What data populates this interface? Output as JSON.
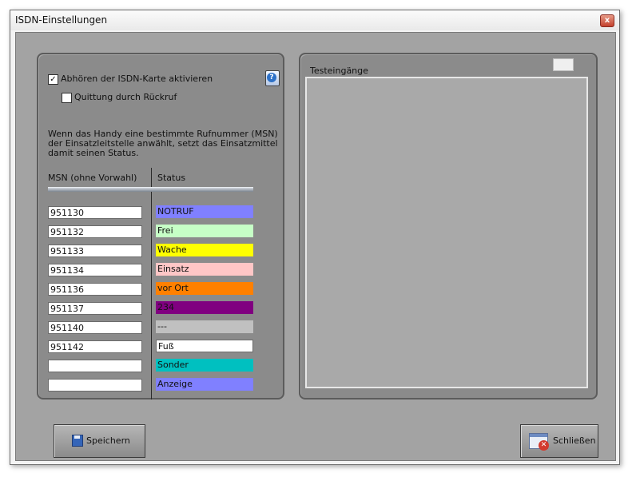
{
  "window": {
    "title": "ISDN-Einstellungen",
    "close_symbol": "x"
  },
  "options": {
    "isdn_listen": {
      "label": "Abhören der ISDN-Karte aktivieren",
      "checked": true
    },
    "callback_ack": {
      "label": "Quittung durch Rückruf",
      "checked": false
    }
  },
  "description": "Wenn das Handy eine bestimmte Rufnummer (MSN)  der Einsatzleitstelle anwählt, setzt das Einsatzmittel damit seinen Status.",
  "table": {
    "col_msn": "MSN (ohne Vorwahl)",
    "col_status": "Status",
    "rows": [
      {
        "msn": "951130",
        "status": "NOTRUF",
        "color": "#8080ff"
      },
      {
        "msn": "951132",
        "status": "Frei",
        "color": "#c6ffc6"
      },
      {
        "msn": "951133",
        "status": "Wache",
        "color": "#ffff00"
      },
      {
        "msn": "951134",
        "status": "Einsatz",
        "color": "#ffc6c6"
      },
      {
        "msn": "951136",
        "status": "vor Ort",
        "color": "#ff8000"
      },
      {
        "msn": "951137",
        "status": "234",
        "color": "#800080"
      },
      {
        "msn": "951140",
        "status": "---",
        "color": "#c0c0c0"
      },
      {
        "msn": "951142",
        "status": "Fuß",
        "color": "#ffffff"
      },
      {
        "msn": "",
        "status": "Sonder",
        "color": "#00c0c0"
      },
      {
        "msn": "",
        "status": "Anzeige",
        "color": "#8080ff"
      }
    ]
  },
  "test": {
    "title": "Testeingänge"
  },
  "buttons": {
    "save": "Speichern",
    "close": "Schließen"
  },
  "icons": {
    "help": "help-icon",
    "save": "floppy-disk-icon",
    "close_window": "close-window-icon"
  }
}
